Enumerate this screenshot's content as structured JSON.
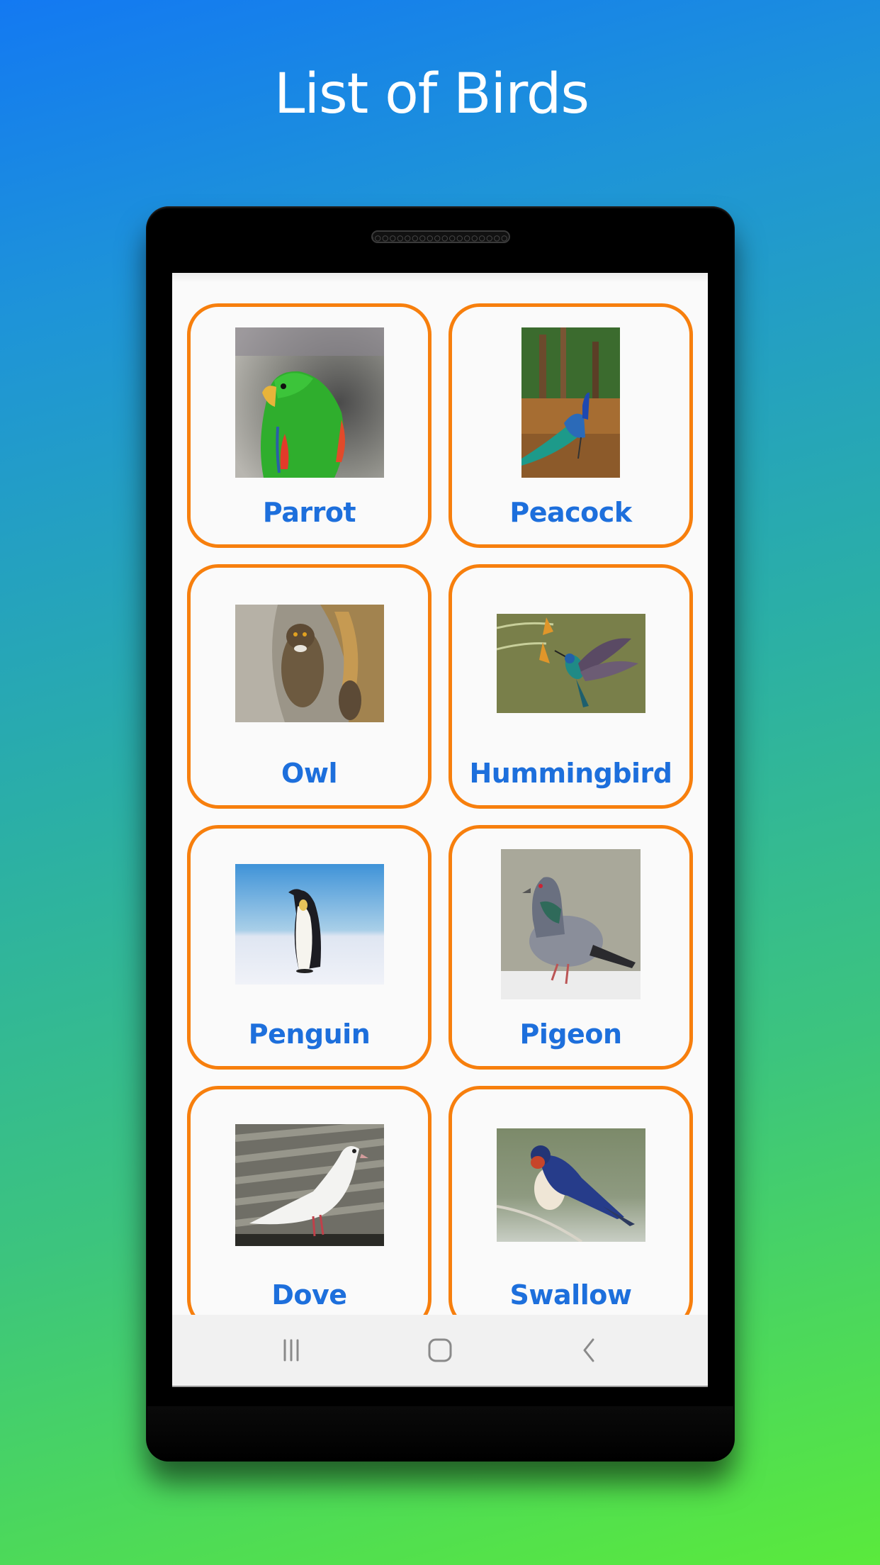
{
  "header": {
    "title": "List of Birds"
  },
  "colors": {
    "card_border": "#f77f0d",
    "label_text": "#1d6fdc",
    "screen_bg": "#fafafa",
    "nav_bg": "#f1f1f1"
  },
  "birds": [
    {
      "name": "Parrot",
      "image": "parrot-photo"
    },
    {
      "name": "Peacock",
      "image": "peacock-photo"
    },
    {
      "name": "Owl",
      "image": "owl-photo"
    },
    {
      "name": "Hummingbird",
      "image": "hummingbird-photo"
    },
    {
      "name": "Penguin",
      "image": "penguin-photo"
    },
    {
      "name": "Pigeon",
      "image": "pigeon-photo"
    },
    {
      "name": "Dove",
      "image": "dove-photo"
    },
    {
      "name": "Swallow",
      "image": "swallow-photo"
    }
  ],
  "navbar": {
    "buttons": [
      {
        "icon": "recent-apps-icon",
        "label": "Recent apps"
      },
      {
        "icon": "home-icon",
        "label": "Home"
      },
      {
        "icon": "back-icon",
        "label": "Back"
      }
    ]
  }
}
